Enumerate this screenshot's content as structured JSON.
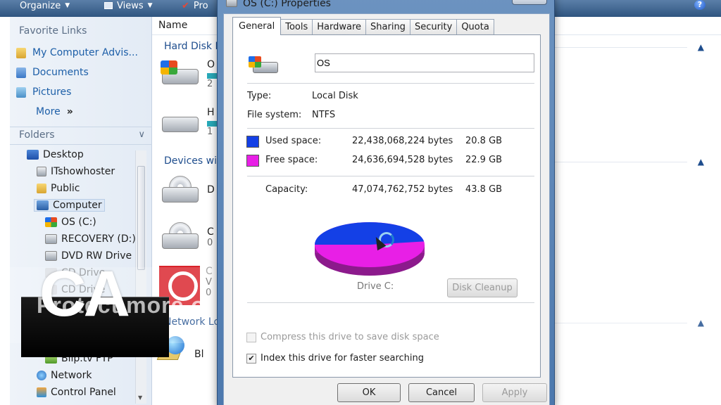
{
  "explorer": {
    "toolbar": {
      "organize": "Organize",
      "views": "Views",
      "properties": "Pro"
    },
    "nav": {
      "favorite_links_heading": "Favorite Links",
      "favorites": [
        "My Computer Advis...",
        "Documents",
        "Pictures"
      ],
      "more": "More",
      "more_glyph": "»",
      "folders_heading": "Folders",
      "tree": [
        "Desktop",
        "ITshowhoster",
        "Public",
        "Computer",
        "OS (C:)",
        "RECOVERY (D:)",
        "DVD RW Drive",
        "CD Drive",
        "CD Drive",
        "Blip.tv FTP",
        "Network",
        "Control Panel"
      ]
    },
    "list": {
      "name_header": "Name",
      "group_hard_disk": "Hard Disk D",
      "group_devices": "Devices wit",
      "group_network": "Network Lo",
      "items": [
        {
          "label": "O",
          "sub": "2"
        },
        {
          "label": "H",
          "sub": "1"
        },
        {
          "label": "D",
          "sub": ""
        },
        {
          "label": "C",
          "sub": "0"
        },
        {
          "label": "C",
          "sub": "V",
          "sub2": "0"
        },
        {
          "label": "Bl",
          "sub": ""
        }
      ]
    }
  },
  "watermark": {
    "logo": "CA",
    "slogan": "Protect more of your memories for less"
  },
  "dialog": {
    "title": "OS (C:) Properties",
    "tabs": [
      "General",
      "Tools",
      "Hardware",
      "Sharing",
      "Security",
      "Quota"
    ],
    "active_tab": "General",
    "drive_name": "OS",
    "type_label": "Type:",
    "type_value": "Local Disk",
    "fs_label": "File system:",
    "fs_value": "NTFS",
    "used_label": "Used space:",
    "used_bytes": "22,438,068,224 bytes",
    "used_gb": "20.8 GB",
    "free_label": "Free space:",
    "free_bytes": "24,636,694,528 bytes",
    "free_gb": "22.9 GB",
    "capacity_label": "Capacity:",
    "capacity_bytes": "47,074,762,752 bytes",
    "capacity_gb": "43.8 GB",
    "drive_caption": "Drive C:",
    "disk_cleanup": "Disk Cleanup",
    "compress_label": "Compress this drive to save disk space",
    "compress_checked": false,
    "index_label": "Index this drive for faster searching",
    "index_checked": true,
    "check_glyph": "✔",
    "ok": "OK",
    "cancel": "Cancel",
    "apply": "Apply",
    "colors": {
      "used": "#1440e6",
      "free": "#e81fe6"
    }
  }
}
